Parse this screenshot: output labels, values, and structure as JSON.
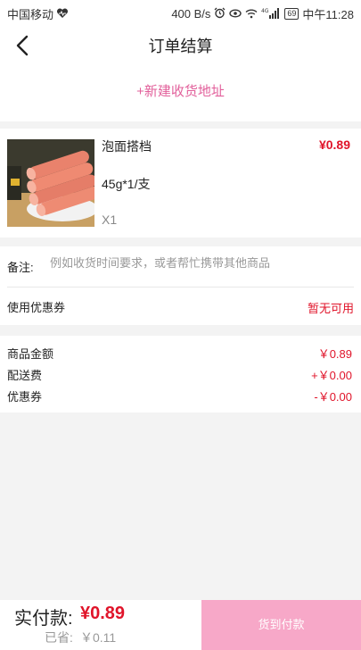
{
  "status_bar": {
    "carrier": "中国移动",
    "net_speed": "400 B/s",
    "network_type": "4G",
    "battery": "69",
    "time": "中午11:28",
    "icons": [
      "heart-monitor-icon",
      "alarm-icon",
      "eye-icon",
      "wifi-icon",
      "signal-icon",
      "battery-icon"
    ]
  },
  "header": {
    "title": "订单结算",
    "back_icon": "chevron-left-icon"
  },
  "address": {
    "add_label": "+新建收货地址"
  },
  "goods": {
    "name": "泡面搭档",
    "spec": "45g*1/支",
    "quantity": "X1",
    "price": "¥0.89"
  },
  "remark": {
    "label": "备注:",
    "placeholder": "例如收货时间要求，或者帮忙携带其他商品"
  },
  "coupon": {
    "label": "使用优惠券",
    "value": "暂无可用"
  },
  "summary": {
    "goods_amount_label": "商品金额",
    "goods_amount_value": "￥0.89",
    "delivery_label": "配送费",
    "delivery_value": "+￥0.00",
    "discount_label": "优惠券",
    "discount_value": "-￥0.00"
  },
  "footer": {
    "pay_label": "实付款:",
    "pay_amount": "¥0.89",
    "saved_label": "已省:",
    "saved_amount": "￥0.11",
    "cod_button": "货到付款"
  },
  "colors": {
    "accent_pink": "#e2609b",
    "price_red": "#e0142a",
    "button_pink": "#f7a8c8",
    "background": "#f3f3f3"
  }
}
